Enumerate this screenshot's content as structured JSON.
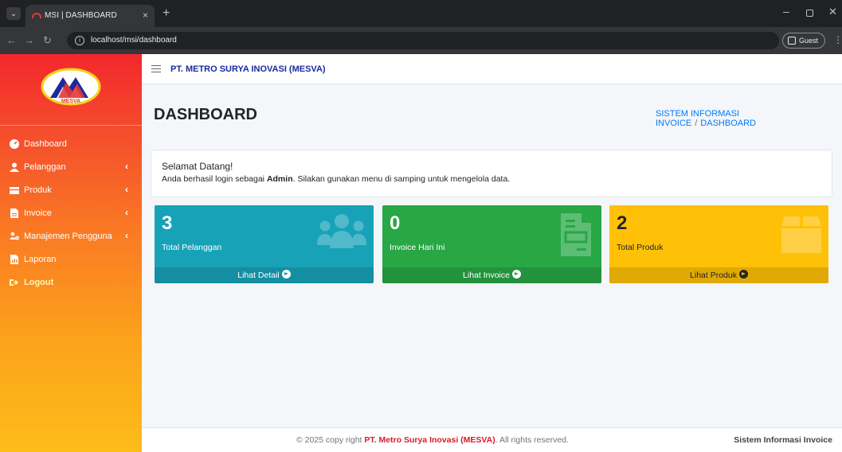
{
  "browser": {
    "tab_title": "MSI | DASHBOARD",
    "url": "localhost/msi/dashboard",
    "guest_label": "Guest"
  },
  "sidebar": {
    "logo_text": "MESVA",
    "items": [
      {
        "label": "Dashboard",
        "icon": "tachometer-icon"
      },
      {
        "label": "Pelanggan",
        "icon": "user-icon"
      },
      {
        "label": "Produk",
        "icon": "box-icon"
      },
      {
        "label": "Invoice",
        "icon": "file-icon"
      },
      {
        "label": "Manajemen Pengguna",
        "icon": "users-cog-icon"
      },
      {
        "label": "Laporan",
        "icon": "report-icon"
      },
      {
        "label": "Logout",
        "icon": "sign-out-icon"
      }
    ]
  },
  "header": {
    "company": "PT. METRO SURYA INOVASI (MESVA)"
  },
  "page": {
    "title": "DASHBOARD",
    "breadcrumb": [
      "SISTEM INFORMASI INVOICE",
      "DASHBOARD"
    ]
  },
  "welcome": {
    "heading": "Selamat Datang!",
    "msg_prefix": "Anda berhasil login sebagai ",
    "role": "Admin",
    "msg_suffix": ". Silakan gunakan menu di samping untuk mengelola data."
  },
  "boxes": [
    {
      "value": "3",
      "label": "Total Pelanggan",
      "link": "Lihat Detail",
      "color": "#17a2b8",
      "icon": "users-icon"
    },
    {
      "value": "0",
      "label": "Invoice Hari Ini",
      "link": "Lihat Invoice",
      "color": "#28a745",
      "icon": "invoice-icon"
    },
    {
      "value": "2",
      "label": "Total Produk",
      "link": "Lihat Produk",
      "color": "#ffc107",
      "icon": "box-icon"
    }
  ],
  "footer": {
    "prefix": "© 2025 copy right ",
    "brand": "PT. Metro Surya Inovasi (MESVA)",
    "suffix": ". All rights reserved.",
    "app_name": "Sistem Informasi Invoice"
  }
}
